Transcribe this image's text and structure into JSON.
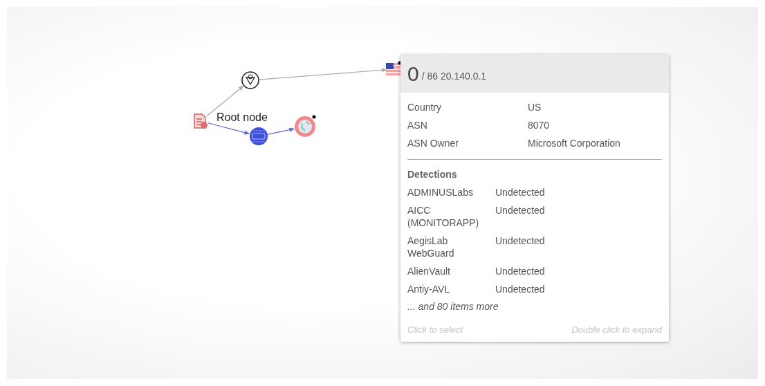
{
  "graph": {
    "root": {
      "kind": "document",
      "label": "Root node",
      "flagged": false,
      "children": [
        {
          "kind": "ip",
          "edge_highlighted": false,
          "flagged": false,
          "children": [
            {
              "kind": "flag",
              "edge_highlighted": false,
              "flagged": true
            }
          ]
        },
        {
          "kind": "www",
          "edge_highlighted": true,
          "flagged": false,
          "children": [
            {
              "kind": "globe",
              "edge_highlighted": true,
              "flagged": true
            }
          ]
        }
      ]
    }
  },
  "popup": {
    "score": "0",
    "subtitle": "/ 86 20.140.0.1",
    "properties": [
      {
        "label": "Country",
        "value": "US"
      },
      {
        "label": "ASN",
        "value": "8070"
      },
      {
        "label": "ASN Owner",
        "value": "Microsoft Corporation"
      }
    ],
    "detections_title": "Detections",
    "detections": [
      {
        "engine": "ADMINUSLabs",
        "result": "Undetected"
      },
      {
        "engine": "AICC (MONITORAPP)",
        "result": "Undetected"
      },
      {
        "engine": "AegisLab WebGuard",
        "result": "Undetected"
      },
      {
        "engine": "AlienVault",
        "result": "Undetected"
      },
      {
        "engine": "Antiy-AVL",
        "result": "Undetected"
      }
    ],
    "more": "... and 80 items more",
    "hint_left": "Click to select",
    "hint_right": "Double click to expand"
  }
}
